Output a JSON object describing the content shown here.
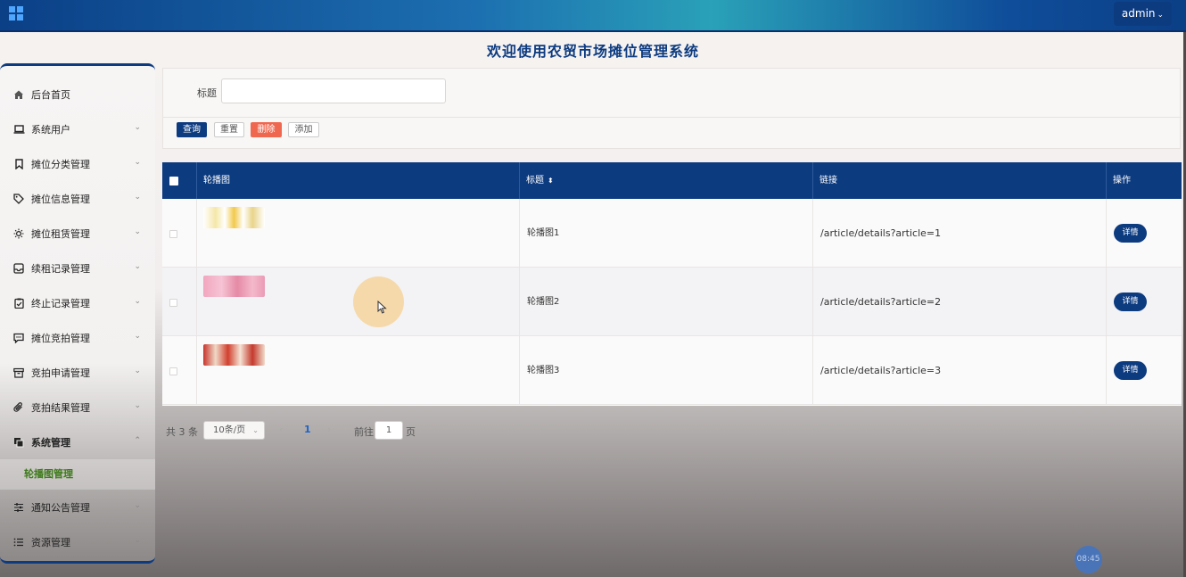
{
  "header": {
    "user_label": "admin",
    "page_title": "欢迎使用农贸市场摊位管理系统"
  },
  "sidebar": {
    "items": [
      {
        "label": "后台首页",
        "icon": "home-icon"
      },
      {
        "label": "系统用户",
        "icon": "laptop-icon"
      },
      {
        "label": "摊位分类管理",
        "icon": "bookmark-icon"
      },
      {
        "label": "摊位信息管理",
        "icon": "tag-icon"
      },
      {
        "label": "摊位租赁管理",
        "icon": "sun-icon"
      },
      {
        "label": "续租记录管理",
        "icon": "inbox-icon"
      },
      {
        "label": "终止记录管理",
        "icon": "clipboard-check-icon"
      },
      {
        "label": "摊位竞拍管理",
        "icon": "message-icon"
      },
      {
        "label": "竞拍申请管理",
        "icon": "archive-icon"
      },
      {
        "label": "竞拍结果管理",
        "icon": "paperclip-icon"
      },
      {
        "label": "系统管理",
        "icon": "copy-icon"
      },
      {
        "label": "通知公告管理",
        "icon": "sliders-icon"
      },
      {
        "label": "资源管理",
        "icon": "list-icon"
      }
    ],
    "active_sub_item": "轮播图管理"
  },
  "search": {
    "title_label": "标题",
    "title_value": "",
    "query_button": "查询",
    "reset_button": "重置",
    "delete_button": "删除",
    "add_button": "添加"
  },
  "table": {
    "columns": [
      "轮播图",
      "标题",
      "链接",
      "操作"
    ],
    "rows": [
      {
        "title": "轮播图1",
        "link": "/article/details?article=1",
        "action": "详情"
      },
      {
        "title": "轮播图2",
        "link": "/article/details?article=2",
        "action": "详情"
      },
      {
        "title": "轮播图3",
        "link": "/article/details?article=3",
        "action": "详情"
      }
    ]
  },
  "pagination": {
    "total": "共 3 条",
    "page_size": "10条/页",
    "current_page": "1",
    "goto_label": "前往",
    "goto_value": "1",
    "page_suffix": "页"
  },
  "clock": "08:45",
  "colors": {
    "primary": "#0d3b80",
    "danger": "#f0674f",
    "active_sub_text": "#3d7a1a"
  }
}
